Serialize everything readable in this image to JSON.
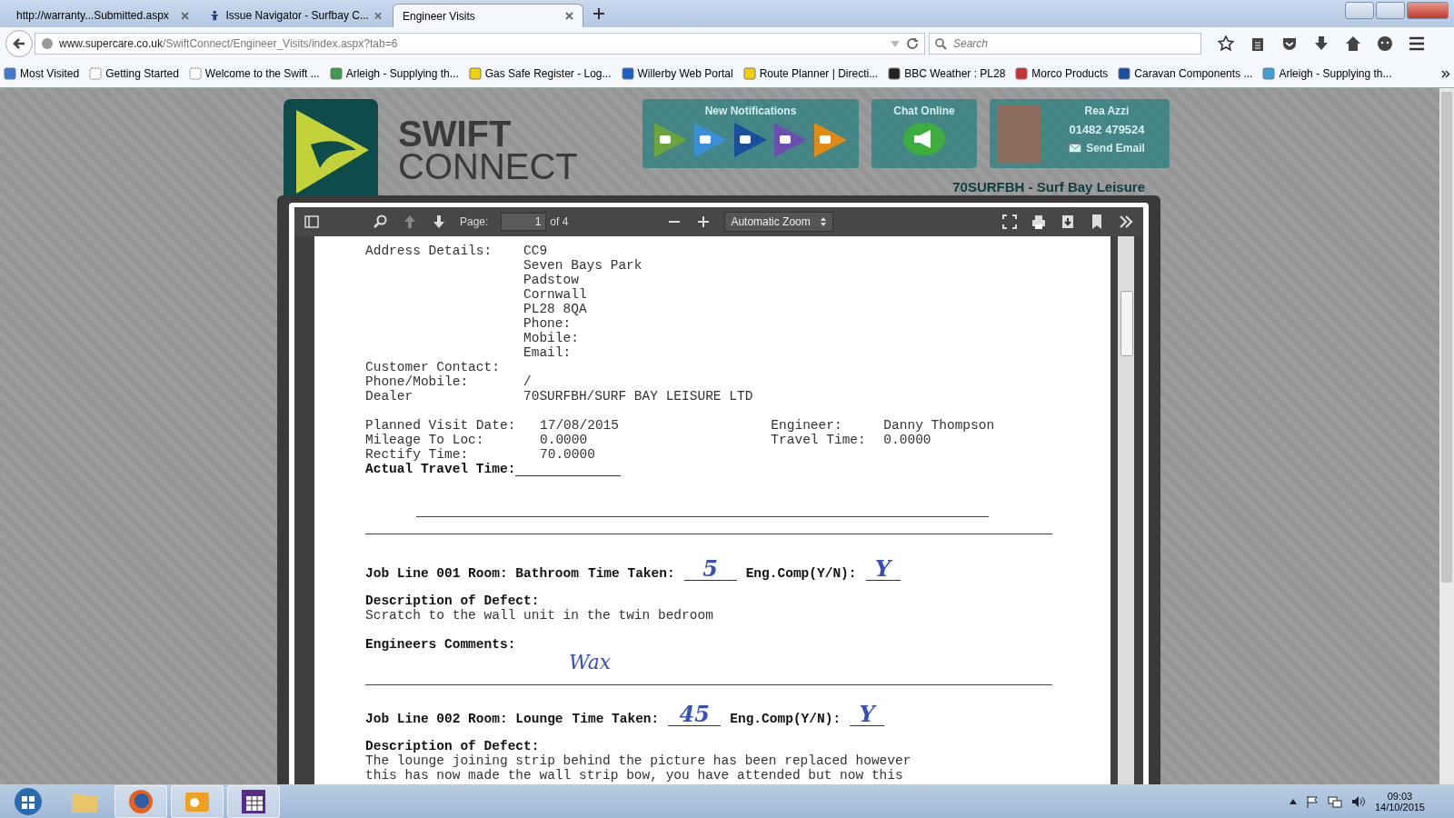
{
  "browser": {
    "tabs": [
      {
        "title": "http://warranty...Submitted.aspx",
        "selected": false
      },
      {
        "title": "Issue Navigator - Surfbay C...",
        "selected": false
      },
      {
        "title": "Engineer Visits",
        "selected": true
      }
    ],
    "url_host": "www.supercare.co.uk",
    "url_path": "/SwiftConnect/Engineer_Visits/index.aspx?tab=6",
    "search_placeholder": "Search",
    "bookmarks": [
      "Most Visited",
      "Getting Started",
      "Welcome to the Swift ...",
      "Arleigh - Supplying th...",
      "Gas Safe Register - Log...",
      "Willerby Web Portal",
      "Route Planner | Directi...",
      "BBC Weather : PL28",
      "Morco Products",
      "Caravan Components ...",
      "Arleigh - Supplying th..."
    ]
  },
  "site": {
    "logo_top": "SWIFT",
    "logo_bottom": "CONNECT",
    "notifications_title": "New Notifications",
    "chat_title": "Chat Online",
    "user_name": "Rea Azzi",
    "user_phone": "01482 479524",
    "send_email": "Send Email",
    "dealer_heading": "70SURFBH - Surf Bay Leisure"
  },
  "viewer": {
    "page_label": "Page:",
    "page": "1",
    "page_count": "of 4",
    "zoom": "Automatic Zoom"
  },
  "document": {
    "address_label": "Address Details:",
    "address_lines": [
      "CC9",
      "Seven Bays Park",
      "Padstow",
      "Cornwall",
      "PL28 8QA",
      "Phone:",
      "Mobile:",
      "Email:"
    ],
    "contacts": [
      {
        "label": "Customer Contact:"
      },
      {
        "label": "Phone/Mobile:",
        "value": "/"
      },
      {
        "label": "Dealer",
        "value": "70SURFBH/SURF BAY LEISURE LTD"
      }
    ],
    "visit_left": [
      {
        "label": "Planned Visit Date:",
        "value": "17/08/2015"
      },
      {
        "label": "Mileage To Loc:",
        "value": "0.0000"
      },
      {
        "label": "Rectify Time:",
        "value": "70.0000"
      }
    ],
    "visit_right": [
      {
        "label": "Engineer:",
        "value": "Danny Thompson"
      },
      {
        "label": "Travel Time:",
        "value": "0.0000"
      }
    ],
    "actual_travel_label": "Actual Travel Time:",
    "job_lines": [
      {
        "heading": "Job Line 001 Room: Bathroom",
        "time_label": "Time Taken:",
        "time": "5",
        "comp_label": "Eng.Comp(Y/N):",
        "comp": "Y",
        "desc_label": "Description of Defect:",
        "desc": [
          "Scratch to the wall unit in the twin bedroom"
        ],
        "comments_label": "Engineers Comments:",
        "comment": "Wax"
      },
      {
        "heading": "Job Line 002 Room: Lounge",
        "time_label": "Time Taken:",
        "time": "45",
        "comp_label": "Eng.Comp(Y/N):",
        "comp": "Y",
        "desc_label": "Description of Defect:",
        "desc": [
          "The lounge joining strip behind the picture has been replaced however",
          "this has now made the wall strip bow, you have attended but now this"
        ]
      }
    ]
  },
  "taskbar": {
    "time": "09:03",
    "date": "14/10/2015"
  }
}
